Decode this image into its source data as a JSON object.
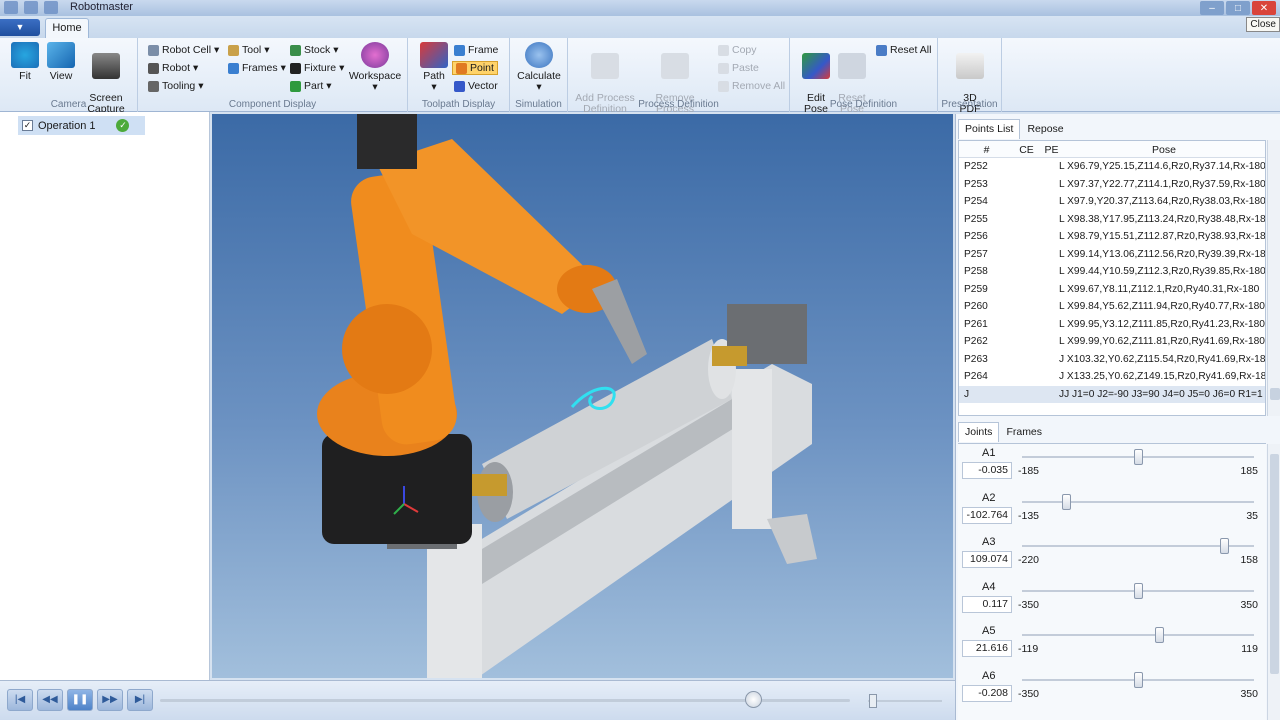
{
  "window": {
    "title": "Robotmaster",
    "tooltip": "Close"
  },
  "tabs": {
    "home": "Home"
  },
  "ribbon": {
    "camera": {
      "label": "Camera",
      "fit": "Fit",
      "view": "View",
      "screen_capture": "Screen\nCapture"
    },
    "component_display": {
      "label": "Component Display",
      "robot_cell": "Robot Cell",
      "robot": "Robot",
      "tooling": "Tooling",
      "tool": "Tool",
      "frames": "Frames",
      "stock": "Stock",
      "fixture": "Fixture",
      "part": "Part",
      "workspace": "Workspace"
    },
    "toolpath_display": {
      "label": "Toolpath Display",
      "path": "Path",
      "frame": "Frame",
      "point": "Point",
      "vector": "Vector"
    },
    "simulation": {
      "label": "Simulation",
      "calculate": "Calculate"
    },
    "process_definition": {
      "label": "Process Definition",
      "add": "Add Process\nDefinition",
      "remove": "Remove Process\nDefinition",
      "copy": "Copy",
      "paste": "Paste",
      "remove_all": "Remove All"
    },
    "pose_definition": {
      "label": "Pose Definition",
      "edit_pose": "Edit\nPose",
      "reset_pose": "Reset\nPose",
      "reset_all": "Reset All"
    },
    "presentation": {
      "label": "Presentation",
      "pdf3d": "3D\nPDF"
    }
  },
  "operations": [
    {
      "label": "Operation 1",
      "checked": true
    }
  ],
  "points_panel": {
    "tabs": [
      "Points List",
      "Repose"
    ],
    "headers": {
      "num": "#",
      "ce": "CE",
      "pe": "PE",
      "pose": "Pose"
    },
    "rows": [
      {
        "id": "P252",
        "pose": "L X96.79,Y25.15,Z114.6,Rz0,Ry37.14,Rx-180"
      },
      {
        "id": "P253",
        "pose": "L X97.37,Y22.77,Z114.1,Rz0,Ry37.59,Rx-180"
      },
      {
        "id": "P254",
        "pose": "L X97.9,Y20.37,Z113.64,Rz0,Ry38.03,Rx-180"
      },
      {
        "id": "P255",
        "pose": "L X98.38,Y17.95,Z113.24,Rz0,Ry38.48,Rx-180"
      },
      {
        "id": "P256",
        "pose": "L X98.79,Y15.51,Z112.87,Rz0,Ry38.93,Rx-180"
      },
      {
        "id": "P257",
        "pose": "L X99.14,Y13.06,Z112.56,Rz0,Ry39.39,Rx-180"
      },
      {
        "id": "P258",
        "pose": "L X99.44,Y10.59,Z112.3,Rz0,Ry39.85,Rx-180"
      },
      {
        "id": "P259",
        "pose": "L X99.67,Y8.11,Z112.1,Rz0,Ry40.31,Rx-180"
      },
      {
        "id": "P260",
        "pose": "L X99.84,Y5.62,Z111.94,Rz0,Ry40.77,Rx-180"
      },
      {
        "id": "P261",
        "pose": "L X99.95,Y3.12,Z111.85,Rz0,Ry41.23,Rx-180"
      },
      {
        "id": "P262",
        "pose": "L X99.99,Y0.62,Z111.81,Rz0,Ry41.69,Rx-180"
      },
      {
        "id": "P263",
        "pose": "J X103.32,Y0.62,Z115.54,Rz0,Ry41.69,Rx-180"
      },
      {
        "id": "P264",
        "pose": "J X133.25,Y0.62,Z149.15,Rz0,Ry41.69,Rx-180"
      },
      {
        "id": "J",
        "pose": "JJ J1=0 J2=-90 J3=90 J4=0 J5=0 J6=0 R1=1"
      }
    ]
  },
  "joints_panel": {
    "tabs": [
      "Joints",
      "Frames"
    ],
    "joints": [
      {
        "name": "A1",
        "value": "-0.035",
        "min": "-185",
        "max": "185",
        "fraction": 0.5
      },
      {
        "name": "A2",
        "value": "-102.764",
        "min": "-135",
        "max": "35",
        "fraction": 0.19
      },
      {
        "name": "A3",
        "value": "109.074",
        "min": "-220",
        "max": "158",
        "fraction": 0.87
      },
      {
        "name": "A4",
        "value": "0.117",
        "min": "-350",
        "max": "350",
        "fraction": 0.5
      },
      {
        "name": "A5",
        "value": "21.616",
        "min": "-119",
        "max": "119",
        "fraction": 0.59
      },
      {
        "name": "A6",
        "value": "-0.208",
        "min": "-350",
        "max": "350",
        "fraction": 0.5
      }
    ]
  },
  "playback": {
    "progress": 0.86,
    "speed": 0.02
  }
}
